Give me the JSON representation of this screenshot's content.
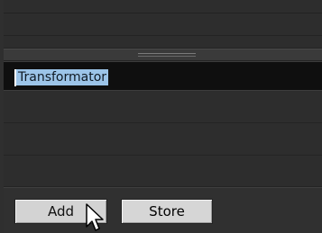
{
  "list": {
    "editing_value": "Transformator"
  },
  "buttons": {
    "add_label": "Add",
    "store_label": "Store"
  },
  "colors": {
    "panel_bg": "#2e2e2e",
    "selection_highlight": "#9cc4e8",
    "edit_row_bg": "#0f0f0f",
    "button_face": "#d3d3d3"
  },
  "icons": {
    "cursor": "mouse-pointer-icon",
    "splitter": "splitter-grip-icon"
  }
}
